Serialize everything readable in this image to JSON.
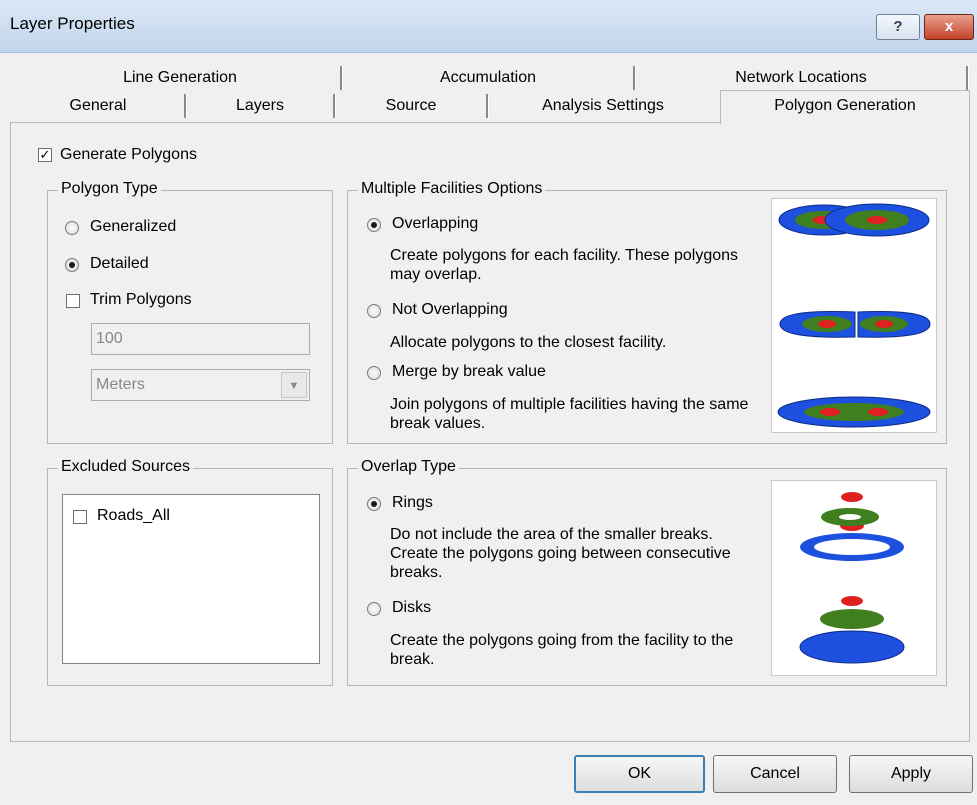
{
  "window": {
    "title": "Layer Properties",
    "help": "?",
    "close": "x"
  },
  "tabs": {
    "row1": [
      {
        "label": "Line Generation"
      },
      {
        "label": "Accumulation"
      },
      {
        "label": "Network Locations"
      }
    ],
    "row2": [
      {
        "label": "General"
      },
      {
        "label": "Layers"
      },
      {
        "label": "Source"
      },
      {
        "label": "Analysis Settings"
      },
      {
        "label": "Polygon Generation",
        "active": true
      }
    ]
  },
  "generate": {
    "label": "Generate Polygons",
    "checked": true
  },
  "polygon_type": {
    "title": "Polygon Type",
    "generalized": "Generalized",
    "detailed": "Detailed",
    "selected": "Detailed",
    "trim_label": "Trim Polygons",
    "trim_checked": false,
    "trim_value": "100",
    "trim_unit": "Meters"
  },
  "multiple_facilities": {
    "title": "Multiple Facilities Options",
    "overlapping": {
      "label": "Overlapping",
      "desc": "Create polygons for each facility. These polygons may overlap."
    },
    "not_overlapping": {
      "label": "Not Overlapping",
      "desc": "Allocate polygons to the closest facility."
    },
    "merge": {
      "label": "Merge by break value",
      "desc": "Join polygons of multiple facilities having the same break values."
    },
    "selected": "Overlapping"
  },
  "excluded_sources": {
    "title": "Excluded Sources",
    "items": [
      {
        "label": "Roads_All",
        "checked": false
      }
    ]
  },
  "overlap_type": {
    "title": "Overlap Type",
    "rings": {
      "label": "Rings",
      "desc": "Do not include the area of the smaller breaks. Create the polygons going between consecutive breaks."
    },
    "disks": {
      "label": "Disks",
      "desc": "Create the polygons going from the facility to the break."
    },
    "selected": "Rings"
  },
  "buttons": {
    "ok": "OK",
    "cancel": "Cancel",
    "apply": "Apply"
  },
  "colors": {
    "outer_blue": "#1e50e0",
    "mid_green": "#3f7f1f",
    "inner_red": "#e02020",
    "active_tab_border": "#b9b9b9"
  }
}
